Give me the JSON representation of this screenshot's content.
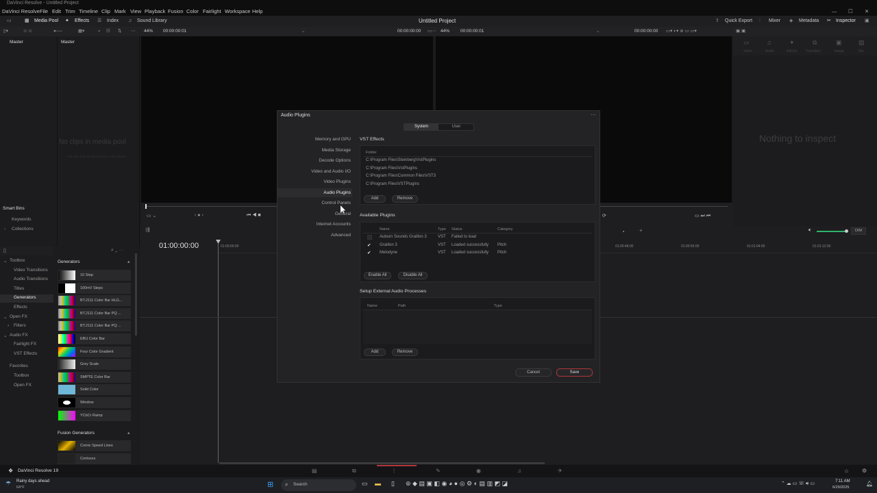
{
  "window": {
    "title": "DaVinci Resolve - Untitled Project"
  },
  "menu": [
    "DaVinci Resolve",
    "File",
    "Edit",
    "Trim",
    "Timeline",
    "Clip",
    "Mark",
    "View",
    "Playback",
    "Fusion",
    "Color",
    "Fairlight",
    "Workspace",
    "Help"
  ],
  "toolbar": {
    "media_pool": "Media Pool",
    "effects": "Effects",
    "index": "Index",
    "sound_library": "Sound Library",
    "project_title": "Untitled Project",
    "quick_export": "Quick Export",
    "mixer": "Mixer",
    "metadata": "Metadata",
    "inspector": "Inspector"
  },
  "subbar": {
    "zoom_left": "44%",
    "tc_left": "00:00:00:01",
    "tc_left_dur": "00:00:00:00",
    "zoom_right": "44%",
    "tc_right": "00:00:00:01",
    "tc_right_dur": "00:00:00:00"
  },
  "bins": {
    "master": "Master",
    "smart_bins": "Smart Bins",
    "keywords": "Keywords",
    "collections": "Collections"
  },
  "media_pool": {
    "header": "Master",
    "empty": "No clips in media pool",
    "hint": "Add clips from Media Storage to get started"
  },
  "inspector": {
    "tabs": [
      "Video",
      "Audio",
      "Effects",
      "Transition",
      "Image",
      "File"
    ],
    "empty": "Nothing to inspect"
  },
  "toolbox": {
    "items": [
      {
        "label": "Toolbox",
        "level": 0,
        "selected": false
      },
      {
        "label": "Video Transitions",
        "level": 1,
        "selected": false
      },
      {
        "label": "Audio Transitions",
        "level": 1,
        "selected": false
      },
      {
        "label": "Titles",
        "level": 1,
        "selected": false
      },
      {
        "label": "Generators",
        "level": 1,
        "selected": true
      },
      {
        "label": "Effects",
        "level": 1,
        "selected": false
      },
      {
        "label": "Open FX",
        "level": 0,
        "selected": false
      },
      {
        "label": "Filters",
        "level": 1,
        "selected": false
      },
      {
        "label": "Audio FX",
        "level": 0,
        "selected": false
      },
      {
        "label": "Fairlight FX",
        "level": 1,
        "selected": false
      },
      {
        "label": "VST Effects",
        "level": 1,
        "selected": false
      }
    ],
    "favorites": "Favorites",
    "fav_items": [
      "Toolbox",
      "Open FX"
    ]
  },
  "generators": {
    "header": "Generators",
    "items": [
      "10 Step",
      "100mV Steps",
      "BT.2111 Color Bar HLG...",
      "BT.2111 Color Bar PQ ...",
      "BT.2111 Color Bar PQ ...",
      "EBU Color Bar",
      "Four Color Gradient",
      "Grey Scale",
      "SMPTE Color Bar",
      "Solid Color",
      "Window",
      "YCbCr Ramp"
    ],
    "fusion_header": "Fusion Generators",
    "fusion_items": [
      "Comic Speed Lines",
      "Contours"
    ]
  },
  "timeline": {
    "timecode": "01:00:00:00",
    "ruler": [
      "01:00:00:00",
      "01:00:48:00",
      "01:00:56:00",
      "01:01:04:00",
      "01:01:12:00"
    ],
    "dim": "DIM"
  },
  "dialog": {
    "title": "Audio Plugins",
    "tabs": [
      "System",
      "User"
    ],
    "active_tab": "System",
    "nav": [
      "Memory and GPU",
      "Media Storage",
      "Decode Options",
      "Video and Audio I/O",
      "Video Plugins",
      "Audio Plugins",
      "Control Panels",
      "General",
      "Internet Accounts",
      "Advanced"
    ],
    "active_nav": "Audio Plugins",
    "vst_title": "VST Effects",
    "folder_header": "Folder",
    "folders": [
      "C:\\Program Files\\Steinberg\\VstPlugins",
      "C:\\Program Files\\VstPlugins",
      "C:\\Program Files\\Common Files\\VST3",
      "C:\\Program Files\\VSTPlugins"
    ],
    "add": "Add",
    "remove": "Remove",
    "available_title": "Available Plugins",
    "plugin_headers": [
      "Name",
      "Type",
      "Status",
      "Category"
    ],
    "plugins": [
      {
        "checked": false,
        "name": "Auburn Sounds Graillon 3",
        "type": "VST",
        "status": "Failed to load",
        "category": ""
      },
      {
        "checked": true,
        "name": "Graillon 3",
        "type": "VST",
        "status": "Loaded successfully",
        "category": "Pitch"
      },
      {
        "checked": true,
        "name": "Melodyne",
        "type": "VST",
        "status": "Loaded successfully",
        "category": "Pitch"
      }
    ],
    "enable_all": "Enable All",
    "disable_all": "Disable All",
    "external_title": "Setup External Audio Processes",
    "external_headers": [
      "Name",
      "Path",
      "Type"
    ],
    "add2": "Add",
    "remove2": "Remove",
    "cancel": "Cancel",
    "save": "Save"
  },
  "bottom": {
    "app": "DaVinci Resolve 19"
  },
  "taskbar": {
    "weather": "Rainy days ahead",
    "temp": "64°F",
    "search": "Search",
    "time": "7:11 AM",
    "date": "6/29/2025"
  }
}
